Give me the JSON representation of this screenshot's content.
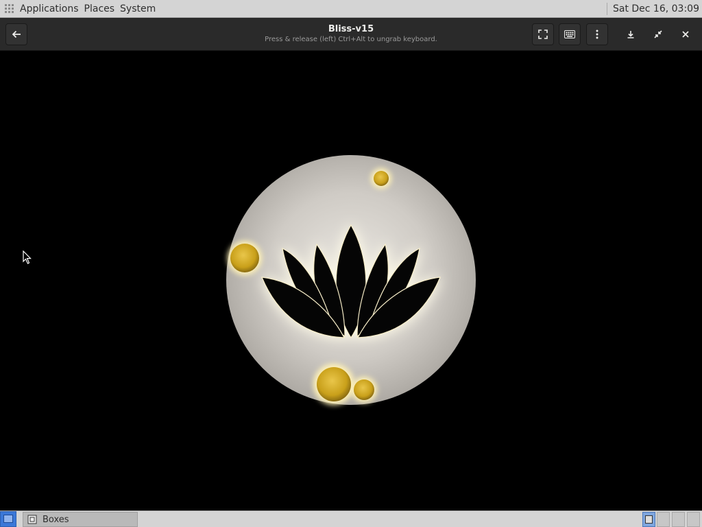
{
  "top_panel": {
    "menus": [
      "Applications",
      "Places",
      "System"
    ],
    "clock": "Sat Dec 16, 03:09"
  },
  "header": {
    "title": "Bliss-v15",
    "subtitle": "Press & release (left) Ctrl+Alt to ungrab keyboard.",
    "icons": [
      "back-arrow-icon",
      "fullscreen-icon",
      "keyboard-icon",
      "kebab-menu-icon",
      "download-icon",
      "unfullscreen-icon",
      "close-icon"
    ]
  },
  "taskbar": {
    "task_label": "Boxes",
    "workspaces": 4,
    "active_workspace": 1
  },
  "colors": {
    "panel_bg": "#d4d4d4",
    "headerbar_bg": "#2a2a2a",
    "logo_disc": "#c9c6c1",
    "logo_glow": "#fff4cf",
    "orb_gold": "#d9b31c"
  }
}
